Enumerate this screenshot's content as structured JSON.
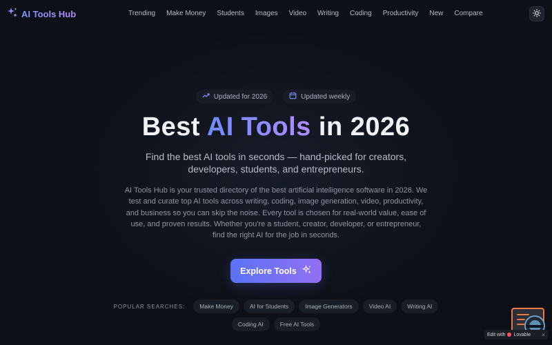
{
  "header": {
    "brand": "AI Tools Hub",
    "nav": [
      "Trending",
      "Make Money",
      "Students",
      "Images",
      "Video",
      "Writing",
      "Coding",
      "Productivity",
      "New",
      "Compare"
    ]
  },
  "badges": {
    "updated_year": "Updated for 2026",
    "updated_freq": "Updated weekly"
  },
  "hero": {
    "title_pre": "Best",
    "title_highlight": "AI Tools",
    "title_post": "in 2026",
    "subtitle": "Find the best AI tools in seconds — hand-picked for creators, developers, students, and entrepreneurs.",
    "description": "AI Tools Hub is your trusted directory of the best artificial intelligence software in 2026. We test and curate top AI tools across writing, coding, image generation, video, productivity, and business so you can skip the noise. Every tool is chosen for real-world value, ease of use, and proven results. Whether you're a student, creator, developer, or entrepreneur, find the right AI for the job in seconds.",
    "cta": "Explore Tools"
  },
  "popular": {
    "label": "POPULAR SEARCHES:",
    "row1": [
      "Make Money",
      "AI for Students",
      "Image Generators",
      "Video AI",
      "Writing AI"
    ],
    "row2": [
      "Coding AI",
      "Free AI Tools"
    ]
  },
  "lovable": {
    "text": "Edit with",
    "brand": "Lovable",
    "close": "×"
  },
  "colors": {
    "background": "#0d1017",
    "accent_start": "#5b72f6",
    "accent_end": "#9270f2"
  }
}
